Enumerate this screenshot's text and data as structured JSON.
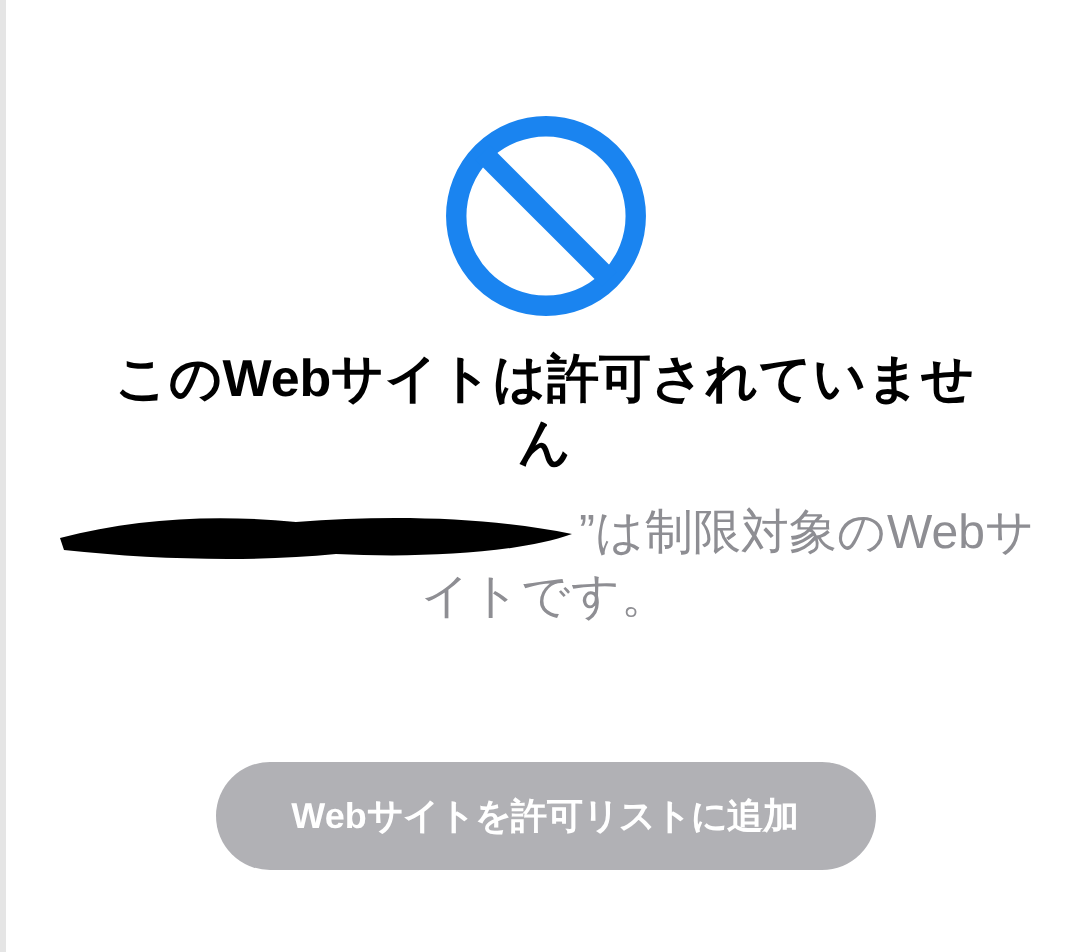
{
  "title": "このWebサイトは許可されていません",
  "message": "”は制限対象のWebサイトです。",
  "button": {
    "label": "Webサイトを許可リストに追加",
    "disabled": true
  }
}
